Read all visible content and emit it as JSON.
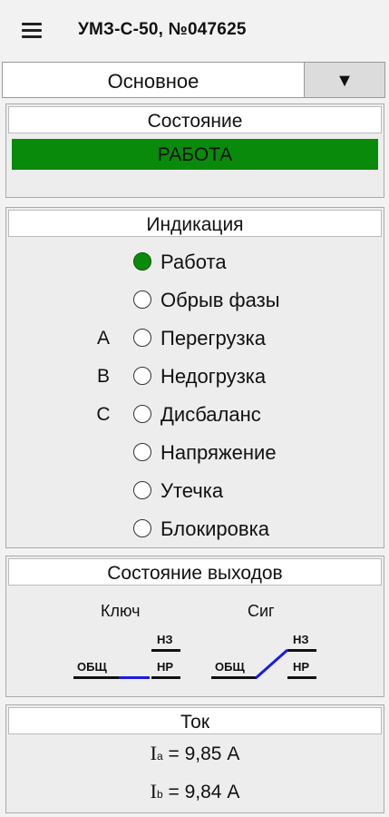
{
  "header": {
    "title": "УМЗ-С-50, №047625",
    "menu_icon": "hamburger-menu-icon"
  },
  "mode_select": {
    "selected": "Основное",
    "arrow": "▼"
  },
  "state": {
    "title": "Состояние",
    "value": "РАБОТА",
    "color": "#0a8a0a"
  },
  "indication": {
    "title": "Индикация",
    "rows": [
      {
        "phase": "",
        "label": "Работа",
        "on": true
      },
      {
        "phase": "",
        "label": "Обрыв фазы",
        "on": false
      },
      {
        "phase": "A",
        "label": "Перегрузка",
        "on": false
      },
      {
        "phase": "B",
        "label": "Недогрузка",
        "on": false
      },
      {
        "phase": "C",
        "label": "Дисбаланс",
        "on": false
      },
      {
        "phase": "",
        "label": "Напряжение",
        "on": false
      },
      {
        "phase": "",
        "label": "Утечка",
        "on": false
      },
      {
        "phase": "",
        "label": "Блокировка",
        "on": false
      }
    ]
  },
  "outputs": {
    "title": "Состояние выходов",
    "key": {
      "label": "Ключ",
      "common": "ОБЩ",
      "nc": "НЗ",
      "no": "НР",
      "state": "closed-to-no"
    },
    "sig": {
      "label": "Сиг",
      "common": "ОБЩ",
      "nc": "НЗ",
      "no": "НР",
      "state": "switched-to-nc"
    }
  },
  "current": {
    "title": "Ток",
    "rows": [
      {
        "symbol": "I",
        "sub": "a",
        "value": "= 9,85 А"
      },
      {
        "symbol": "I",
        "sub": "b",
        "value": "= 9,84 А"
      }
    ]
  }
}
